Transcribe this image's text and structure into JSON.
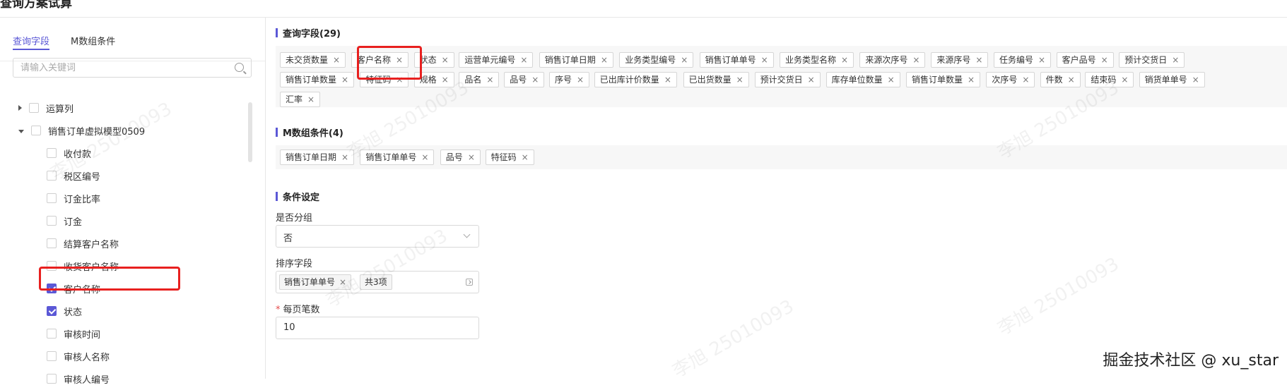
{
  "header": {
    "title": "查询方案试算"
  },
  "sidebar": {
    "tabs": [
      {
        "label": "查询字段",
        "active": true
      },
      {
        "label": "M数组条件",
        "active": false
      }
    ],
    "search": {
      "placeholder": "请输入关键词"
    },
    "tree": [
      {
        "label": "运算列",
        "level": 0,
        "expanded": false,
        "checked": false
      },
      {
        "label": "销售订单虚拟模型0509",
        "level": 0,
        "expanded": true,
        "checked": false
      },
      {
        "label": "收付款",
        "level": 1,
        "checked": false
      },
      {
        "label": "税区编号",
        "level": 1,
        "checked": false
      },
      {
        "label": "订金比率",
        "level": 1,
        "checked": false
      },
      {
        "label": "订金",
        "level": 1,
        "checked": false
      },
      {
        "label": "结算客户名称",
        "level": 1,
        "checked": false
      },
      {
        "label": "收货客户名称",
        "level": 1,
        "checked": false
      },
      {
        "label": "客户名称",
        "level": 1,
        "checked": true
      },
      {
        "label": "状态",
        "level": 1,
        "checked": true
      },
      {
        "label": "审核时间",
        "level": 1,
        "checked": false
      },
      {
        "label": "审核人名称",
        "level": 1,
        "checked": false
      },
      {
        "label": "审核人编号",
        "level": 1,
        "checked": false
      }
    ]
  },
  "main": {
    "query_fields": {
      "title": "查询字段(29)",
      "tags": [
        [
          "未交货数量",
          "客户名称",
          "状态",
          "运营单元编号",
          "销售订单日期",
          "业务类型编号",
          "销售订单单号",
          "业务类型名称",
          "来源次序号",
          "来源序号",
          "任务编号",
          "客户品号",
          "预计交货日"
        ],
        [
          "销售订单数量",
          "特征码",
          "规格",
          "品名",
          "品号",
          "序号",
          "已出库计价数量",
          "已出货数量",
          "预计交货日",
          "库存单位数量",
          "销售订单数量",
          "次序号",
          "件数",
          "结束码",
          "销货单单号"
        ],
        [
          "汇率"
        ]
      ]
    },
    "m_conditions": {
      "title": "M数组条件(4)",
      "tags": [
        "销售订单日期",
        "销售订单单号",
        "品号",
        "特征码"
      ]
    },
    "condition_settings": {
      "title": "条件设定",
      "group_label": "是否分组",
      "group_value": "否",
      "sort_label": "排序字段",
      "sort_chip": "销售订单单号",
      "sort_count": "共3项",
      "page_size_label": "每页笔数",
      "page_size_required": "*",
      "page_size_value": "10"
    },
    "close_symbol": "×"
  },
  "watermark": "李旭 25010093",
  "credit": "掘金技术社区 @ xu_star",
  "colors": {
    "accent": "#5b58d6",
    "highlight": "#e8201f"
  }
}
